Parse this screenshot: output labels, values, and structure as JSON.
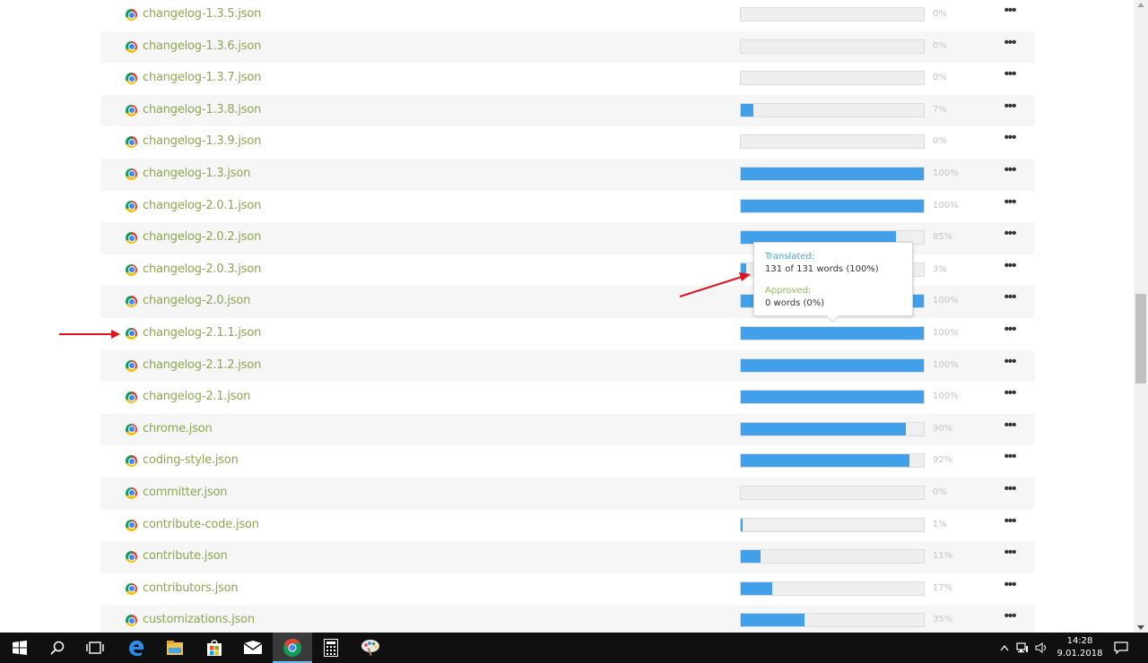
{
  "files": [
    {
      "name": "changelog-1.3.5.json",
      "pct_label": "0%",
      "progress": 0
    },
    {
      "name": "changelog-1.3.6.json",
      "pct_label": "0%",
      "progress": 0
    },
    {
      "name": "changelog-1.3.7.json",
      "pct_label": "0%",
      "progress": 0
    },
    {
      "name": "changelog-1.3.8.json",
      "pct_label": "7%",
      "progress": 7
    },
    {
      "name": "changelog-1.3.9.json",
      "pct_label": "0%",
      "progress": 0
    },
    {
      "name": "changelog-1.3.json",
      "pct_label": "100%",
      "progress": 100
    },
    {
      "name": "changelog-2.0.1.json",
      "pct_label": "100%",
      "progress": 100
    },
    {
      "name": "changelog-2.0.2.json",
      "pct_label": "85%",
      "progress": 85
    },
    {
      "name": "changelog-2.0.3.json",
      "pct_label": "3%",
      "progress": 3
    },
    {
      "name": "changelog-2.0.json",
      "pct_label": "100%",
      "progress": 100
    },
    {
      "name": "changelog-2.1.1.json",
      "pct_label": "100%",
      "progress": 100
    },
    {
      "name": "changelog-2.1.2.json",
      "pct_label": "100%",
      "progress": 100
    },
    {
      "name": "changelog-2.1.json",
      "pct_label": "100%",
      "progress": 100
    },
    {
      "name": "chrome.json",
      "pct_label": "90%",
      "progress": 90
    },
    {
      "name": "coding-style.json",
      "pct_label": "92%",
      "progress": 92
    },
    {
      "name": "committer.json",
      "pct_label": "0%",
      "progress": 0
    },
    {
      "name": "contribute-code.json",
      "pct_label": "1%",
      "progress": 1
    },
    {
      "name": "contribute.json",
      "pct_label": "11%",
      "progress": 11
    },
    {
      "name": "contributors.json",
      "pct_label": "17%",
      "progress": 17
    },
    {
      "name": "customizations.json",
      "pct_label": "35%",
      "progress": 35
    }
  ],
  "more_label": "•••",
  "tooltip": {
    "translated_label": "Translated:",
    "translated_value": "131 of 131 words (100%)",
    "approved_label": "Approved:",
    "approved_value": "0 words (0%)"
  },
  "colors": {
    "progress_fill": "#42a0ea",
    "file_name": "#8aa84e",
    "annotation_arrow": "#e0141e",
    "approved": "#8bc34a"
  },
  "taskbar": {
    "apps": [
      "start-icon",
      "search-icon",
      "task-view-icon",
      "edge-icon",
      "file-explorer-icon",
      "store-icon",
      "mail-icon",
      "chrome-icon",
      "calculator-icon",
      "paint-icon"
    ],
    "active_app": "chrome-icon"
  },
  "clock": {
    "time": "14:28",
    "date": "9.01.2018"
  }
}
